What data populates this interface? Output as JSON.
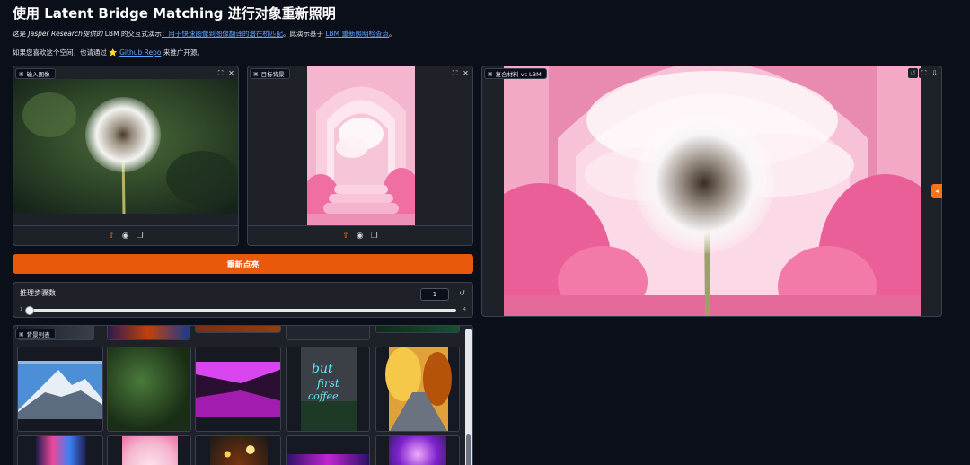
{
  "title": "使用 Latent Bridge Matching 进行对象重新照明",
  "intro": {
    "prefix": "这是",
    "org": "Jasper Research",
    "provided": "提供的",
    "middle": "LBM 的交互式演示",
    "link1": "：用于快速图像到图像翻译的潜在桥匹配",
    "after_link1": "。此演示基于",
    "link2": "LBM 重新照明检查点",
    "end": "。"
  },
  "promo": {
    "prefix": "如果您喜欢这个空间，也请通过",
    "star": "⭐",
    "link": "Github Repo",
    "suffix": "来推广开源。"
  },
  "panels": {
    "input_image": {
      "label": "输入图像",
      "label_icon": "image-icon"
    },
    "target_background": {
      "label": "目标背景",
      "label_icon": "image-icon"
    },
    "composite": {
      "label": "复合材料 vs LBM",
      "label_icon": "image-icon"
    }
  },
  "icons": {
    "fullscreen": "⛶",
    "close": "✕",
    "upload": "⇧",
    "webcam": "◉",
    "clipboard": "❐",
    "undo": "↺",
    "download": "⇩"
  },
  "relight_button": "重新点亮",
  "steps": {
    "label": "推理步骤数",
    "value": "1",
    "min": "1",
    "max": "4",
    "fraction": 0.0
  },
  "gallery": {
    "label": "背景列表",
    "label_icon": "image-icon"
  },
  "colors": {
    "accent": "#ea580c",
    "background": "#0b0f19",
    "panel": "#1f2128",
    "link": "#60a5fa"
  }
}
